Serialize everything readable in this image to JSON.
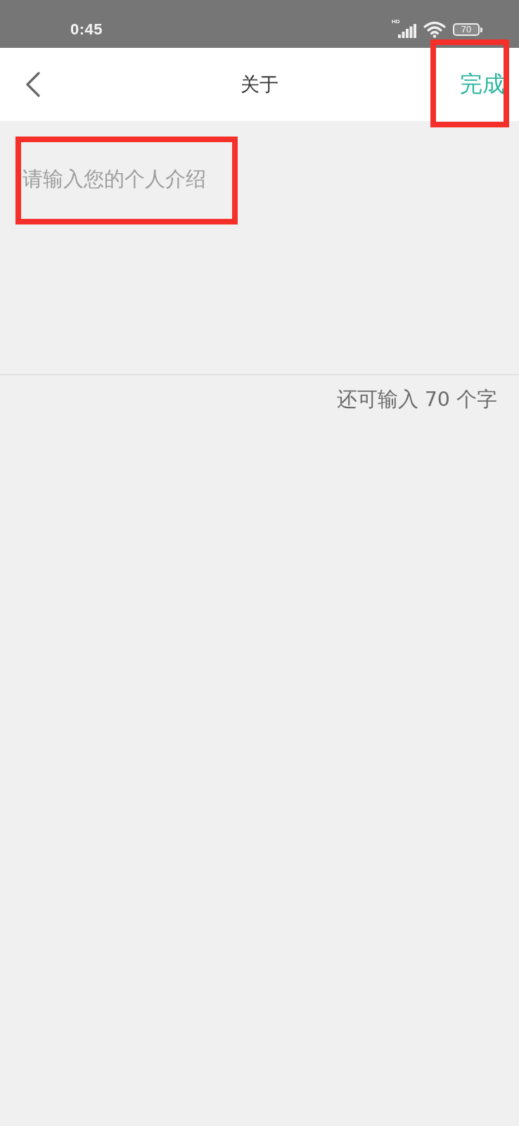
{
  "status_bar": {
    "time": "0:45",
    "network_badge": "HD",
    "battery": "70"
  },
  "header": {
    "title": "关于",
    "done_button": {
      "label": "完成",
      "highlighted": true
    }
  },
  "bio_field": {
    "placeholder": "请输入您的个人介绍",
    "highlighted": true
  },
  "counter": "还可输入 70 个字"
}
